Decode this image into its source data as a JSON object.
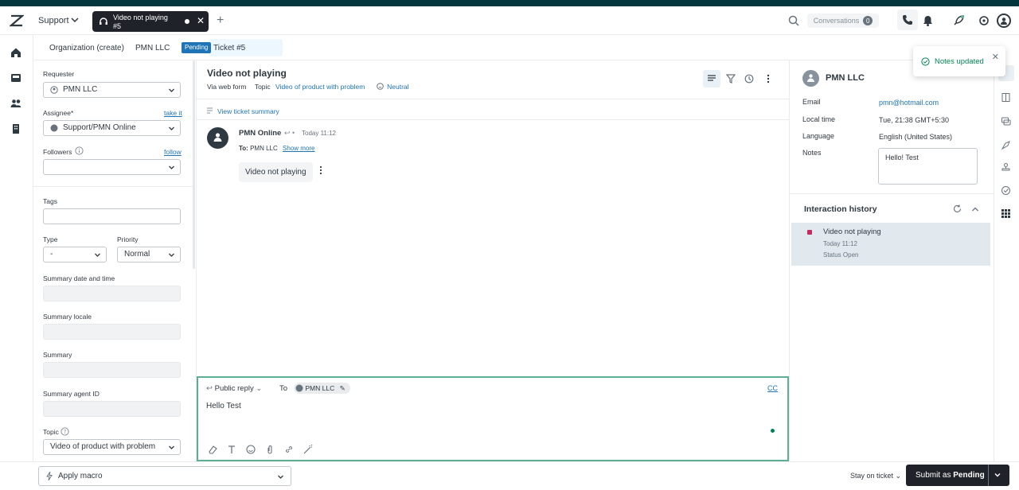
{
  "topbar": {
    "product": "Support",
    "active_tab": {
      "line1": "Video not playing",
      "line2": "#5"
    },
    "conversations": {
      "label": "Conversations",
      "count": "0"
    }
  },
  "breadcrumb": {
    "items": [
      "Organization (create)",
      "PMN LLC"
    ],
    "status_pill": "Pending",
    "ticket": "Ticket #5"
  },
  "left": {
    "requester_label": "Requester",
    "requester_value": "PMN LLC",
    "assignee_label": "Assignee*",
    "take_it": "take it",
    "assignee_value": "Support/PMN Online",
    "followers_label": "Followers",
    "follow": "follow",
    "tags_label": "Tags",
    "type_label": "Type",
    "type_value": "-",
    "priority_label": "Priority",
    "priority_value": "Normal",
    "summary_dt_label": "Summary date and time",
    "summary_locale_label": "Summary locale",
    "summary_label": "Summary",
    "summary_agent_label": "Summary agent ID",
    "topic_label": "Topic",
    "topic_value": "Video of product with problem"
  },
  "conversation": {
    "title": "Video not playing",
    "via": "Via web form",
    "topic_key": "Topic",
    "topic_value": "Video of product with problem",
    "sentiment": "Neutral",
    "summary_link": "View ticket summary",
    "message": {
      "author": "PMN Online",
      "time": "Today 11:12",
      "to_label": "To:",
      "to_value": "PMN LLC",
      "show_more": "Show more",
      "body": "Video not playing"
    }
  },
  "editor": {
    "reply_type": "Public reply",
    "to_label": "To",
    "recipient": "PMN LLC",
    "cc": "CC",
    "text": "Hello Test"
  },
  "right": {
    "name": "PMN LLC",
    "email_label": "Email",
    "email_value": "pmn@hotmail.com",
    "localtime_label": "Local time",
    "localtime_value": "Tue, 21:38 GMT+5:30",
    "language_label": "Language",
    "language_value": "English (United States)",
    "notes_label": "Notes",
    "notes_value": "Hello! Test",
    "history_title": "Interaction history",
    "history": {
      "title": "Video not playing",
      "time": "Today 11:12",
      "status": "Status Open"
    }
  },
  "bottom": {
    "macro": "Apply macro",
    "stay": "Stay on ticket",
    "submit_prefix": "Submit as ",
    "submit_status": "Pending"
  },
  "toast": {
    "text": "Notes updated"
  },
  "colors": {
    "accent": "#1f73b7",
    "dark": "#1f2329",
    "success": "#038153",
    "history_marker": "#c72a5c"
  }
}
